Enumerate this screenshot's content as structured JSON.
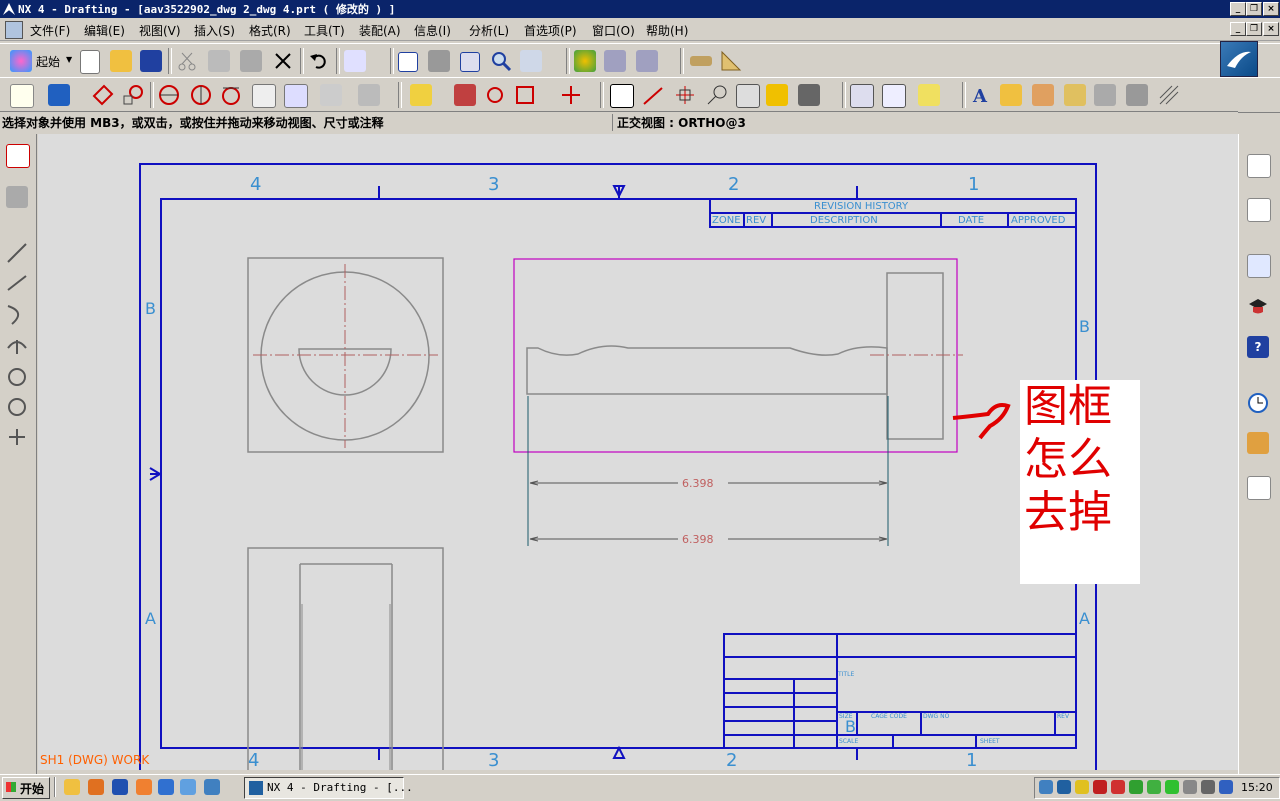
{
  "window": {
    "title": "NX 4 - Drafting - [aav3522902_dwg 2_dwg 4.prt ( 修改的 ) ]"
  },
  "menubar": {
    "items": [
      "文件(F)",
      "编辑(E)",
      "视图(V)",
      "插入(S)",
      "格式(R)",
      "工具(T)",
      "装配(A)",
      "信息(I)",
      "分析(L)",
      "首选项(P)",
      "窗口(O)",
      "帮助(H)"
    ]
  },
  "toolbar": {
    "start_label": "起始"
  },
  "cue_line": {
    "message": "选择对象并使用 MB3，或双击，或按住并拖动来移动视图、尺寸或注释",
    "status": "正交视图 : ORTHO@3"
  },
  "drawing": {
    "zone_numbers_top": [
      "4",
      "3",
      "2",
      "1"
    ],
    "zone_numbers_bottom": [
      "4",
      "3",
      "2",
      "1"
    ],
    "zone_letters_left": [
      "B",
      "A"
    ],
    "zone_letters_right": [
      "B",
      "A"
    ],
    "revision_history": {
      "title": "REVISION HISTORY",
      "columns": [
        "ZONE",
        "REV",
        "DESCRIPTION",
        "DATE",
        "APPROVED"
      ]
    },
    "dimensions": [
      "6.398",
      "6.398"
    ],
    "title_block": {
      "title_label": "TITLE",
      "size_label": "SIZE",
      "cage_code_label": "CAGE CODE",
      "dwg_no_label": "DWG NO",
      "rev_label": "REV",
      "scale_label": "SCALE",
      "sheet_label": "SHEET"
    },
    "sheet_status": "SH1 (DWG) WORK"
  },
  "annotation": {
    "text": "图框怎么去掉",
    "color": "#e00000"
  },
  "taskbar": {
    "start_label": "开始",
    "task_item": "NX 4 - Drafting - [...",
    "clock": "15:20"
  },
  "colors": {
    "title_bar": "#0a246a",
    "border_blue": "#1010c0",
    "zone_text": "#3a8fd0",
    "geometry": "#8a8a8a",
    "selection_magenta": "#c000c0",
    "dimension": "#c06060"
  }
}
